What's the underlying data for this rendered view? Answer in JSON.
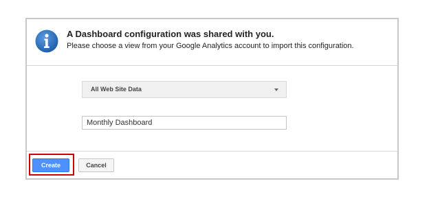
{
  "dialog": {
    "title": "A Dashboard configuration was shared with you.",
    "subtitle": "Please choose a view from your Google Analytics account to import this configuration.",
    "icon": "info-icon"
  },
  "view_select": {
    "selected": "All Web Site Data"
  },
  "dashboard_name": {
    "value": "Monthly Dashboard"
  },
  "footer": {
    "create_label": "Create",
    "cancel_label": "Cancel"
  },
  "colors": {
    "accent": "#4d90fe",
    "highlight": "#cc0000",
    "icon": "#2f6fbf"
  }
}
